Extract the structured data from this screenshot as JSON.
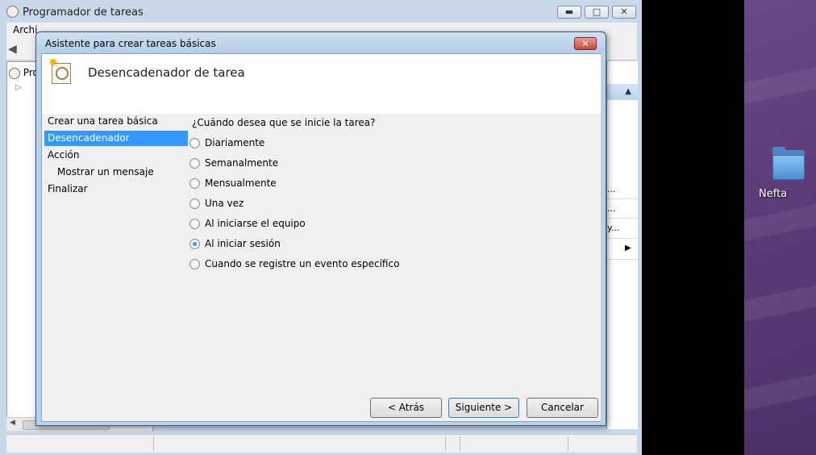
{
  "main_window": {
    "title": "Programador de tareas",
    "menu_first": "Archi",
    "tree_root": "Progra",
    "tree_expand": "▷",
    "actions_trunc_1": "...",
    "actions_trunc_2": "...",
    "actions_trunc_3": "y...",
    "actions_arrow": "▶",
    "actions_header_arrow": "▲",
    "back_arrow": "◀",
    "caption_min": "▬",
    "caption_max": "□",
    "caption_close": "✕"
  },
  "desktop": {
    "folder_label": "Nefta",
    "folder_icon": "folder-icon",
    "accent": "#5b3b78"
  },
  "wizard": {
    "title": "Asistente para crear tareas básicas",
    "close_glyph": "✕",
    "heading": "Desencadenador de tarea",
    "nav": [
      {
        "label": "Crear una tarea básica",
        "selected": false
      },
      {
        "label": "Desencadenador",
        "selected": true
      },
      {
        "label": "Acción",
        "selected": false
      },
      {
        "label": "Mostrar un mensaje",
        "selected": false
      },
      {
        "label": "Finalizar",
        "selected": false
      }
    ],
    "question": "¿Cuándo desea que se inicie la tarea?",
    "options": [
      {
        "label": "Diariamente",
        "checked": false
      },
      {
        "label": "Semanalmente",
        "checked": false
      },
      {
        "label": "Mensualmente",
        "checked": false
      },
      {
        "label": "Una vez",
        "checked": false
      },
      {
        "label": "Al iniciarse el equipo",
        "checked": false
      },
      {
        "label": "Al iniciar sesión",
        "checked": true
      },
      {
        "label": "Cuando se registre un evento específico",
        "checked": false
      }
    ],
    "buttons": {
      "back": "< Atrás",
      "next": "Siguiente >",
      "cancel": "Cancelar"
    },
    "selection_color": "#3399ff"
  }
}
